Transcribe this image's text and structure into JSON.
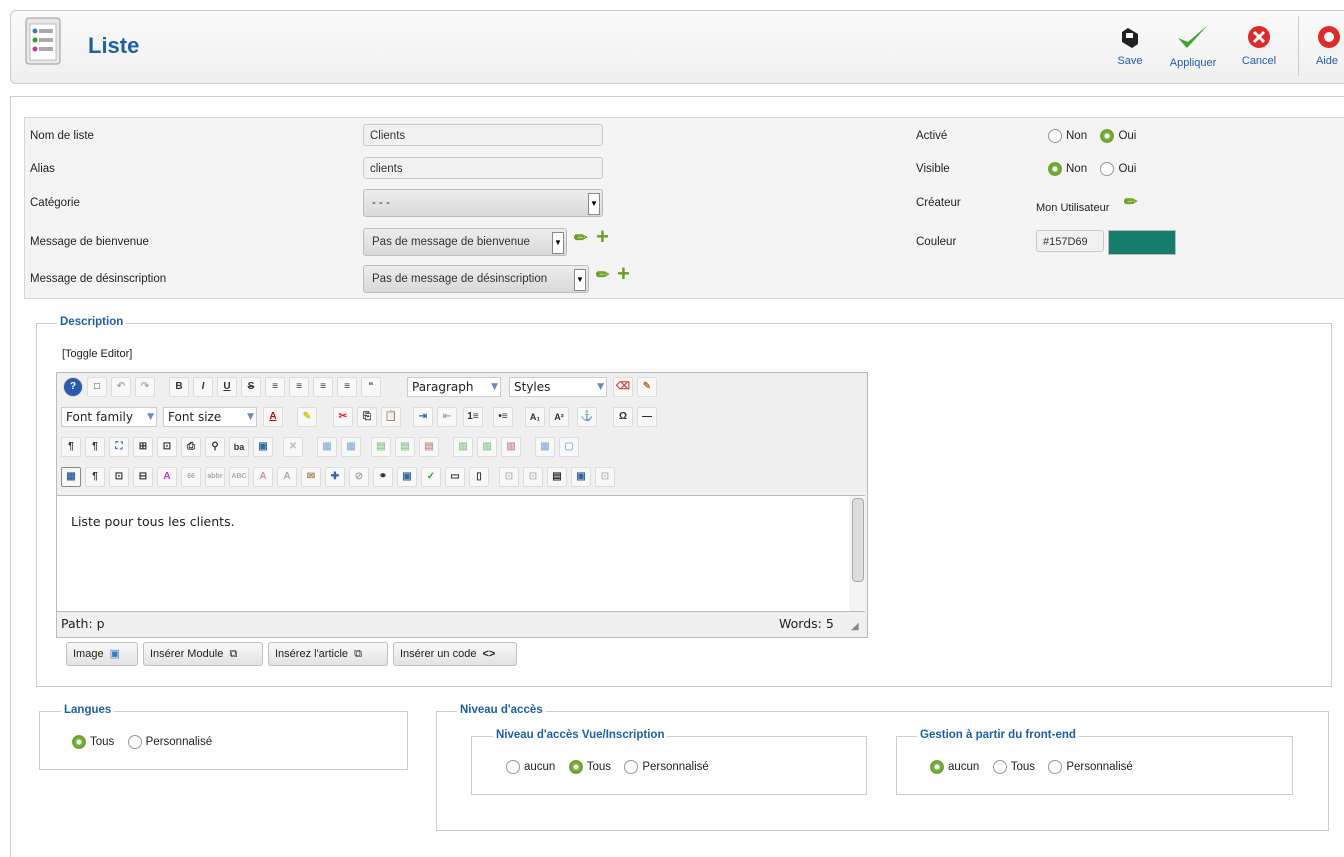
{
  "header": {
    "title": "Liste",
    "buttons": [
      {
        "label": "Save",
        "icon": "save-icon"
      },
      {
        "label": "Appliquer",
        "icon": "checkmark-icon"
      },
      {
        "label": "Cancel",
        "icon": "cancel-icon"
      },
      {
        "label": "Aide",
        "icon": "help-lifebuoy-icon"
      }
    ]
  },
  "form": {
    "name_label": "Nom de liste",
    "name_value": "Clients",
    "alias_label": "Alias",
    "alias_value": "clients",
    "category_label": "Catégorie",
    "category_value": "- - -",
    "welcome_label": "Message de bienvenue",
    "welcome_value": "Pas de message de bienvenue",
    "unsub_label": "Message de désinscription",
    "unsub_value": "Pas de message de désinscription",
    "active_label": "Activé",
    "active_options": [
      "Non",
      "Oui"
    ],
    "active_selected": "Oui",
    "visible_label": "Visible",
    "visible_options": [
      "Non",
      "Oui"
    ],
    "visible_selected": "Non",
    "creator_label": "Créateur",
    "creator_value": "Mon Utilisateur",
    "color_label": "Couleur",
    "color_value": "#157D69",
    "color_swatch": "#157D69"
  },
  "description": {
    "legend": "Description",
    "toggle": "[Toggle Editor]",
    "paragraph_select": "Paragraph",
    "styles_select": "Styles",
    "font_family": "Font family",
    "font_size": "Font size",
    "content": "Liste pour tous les clients.",
    "path": "Path: p",
    "words": "Words: 5",
    "buttons": [
      "Image",
      "Insérer Module",
      "Insérez l'article",
      "Insérer un code"
    ]
  },
  "langues": {
    "legend": "Langues",
    "options": [
      "Tous",
      "Personnalisé"
    ],
    "selected": "Tous"
  },
  "acces": {
    "legend": "Niveau d'accès",
    "vue": {
      "legend": "Niveau d'accès Vue/Inscription",
      "options": [
        "aucun",
        "Tous",
        "Personnalisé"
      ],
      "selected": "Tous"
    },
    "front": {
      "legend": "Gestion à partir du front-end",
      "options": [
        "aucun",
        "Tous",
        "Personnalisé"
      ],
      "selected": "aucun"
    }
  }
}
